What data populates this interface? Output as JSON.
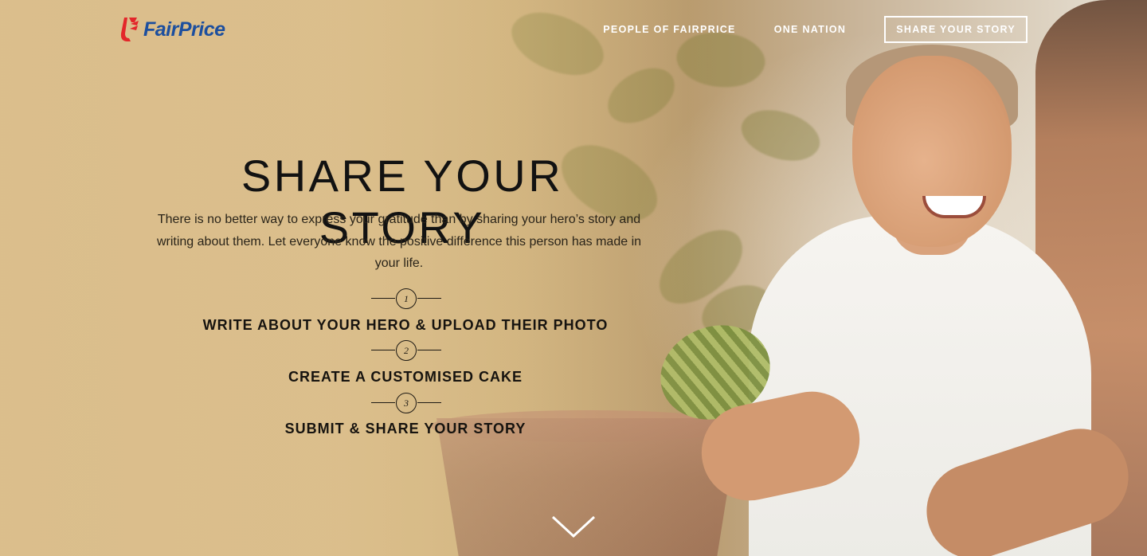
{
  "header": {
    "logo_text": "FairPrice",
    "nav": [
      {
        "label": "PEOPLE OF FAIRPRICE"
      },
      {
        "label": "ONE NATION"
      },
      {
        "label": "SHARE YOUR STORY"
      }
    ]
  },
  "hero": {
    "title": "SHARE YOUR STORY",
    "description": "There is no better way to express your gratitude than by sharing your hero’s story and writing about them. Let everyone know the positive difference this person has made in your life.",
    "steps": [
      {
        "number": "1",
        "label": "WRITE ABOUT YOUR HERO & UPLOAD THEIR PHOTO"
      },
      {
        "number": "2",
        "label": "CREATE A CUSTOMISED CAKE"
      },
      {
        "number": "3",
        "label": "SUBMIT & SHARE YOUR STORY"
      }
    ]
  },
  "colors": {
    "brand_blue": "#1d4f9e",
    "brand_red": "#e3262a"
  },
  "icons": {
    "logo": "fairprice-logo-icon",
    "scroll": "chevron-down-icon"
  }
}
